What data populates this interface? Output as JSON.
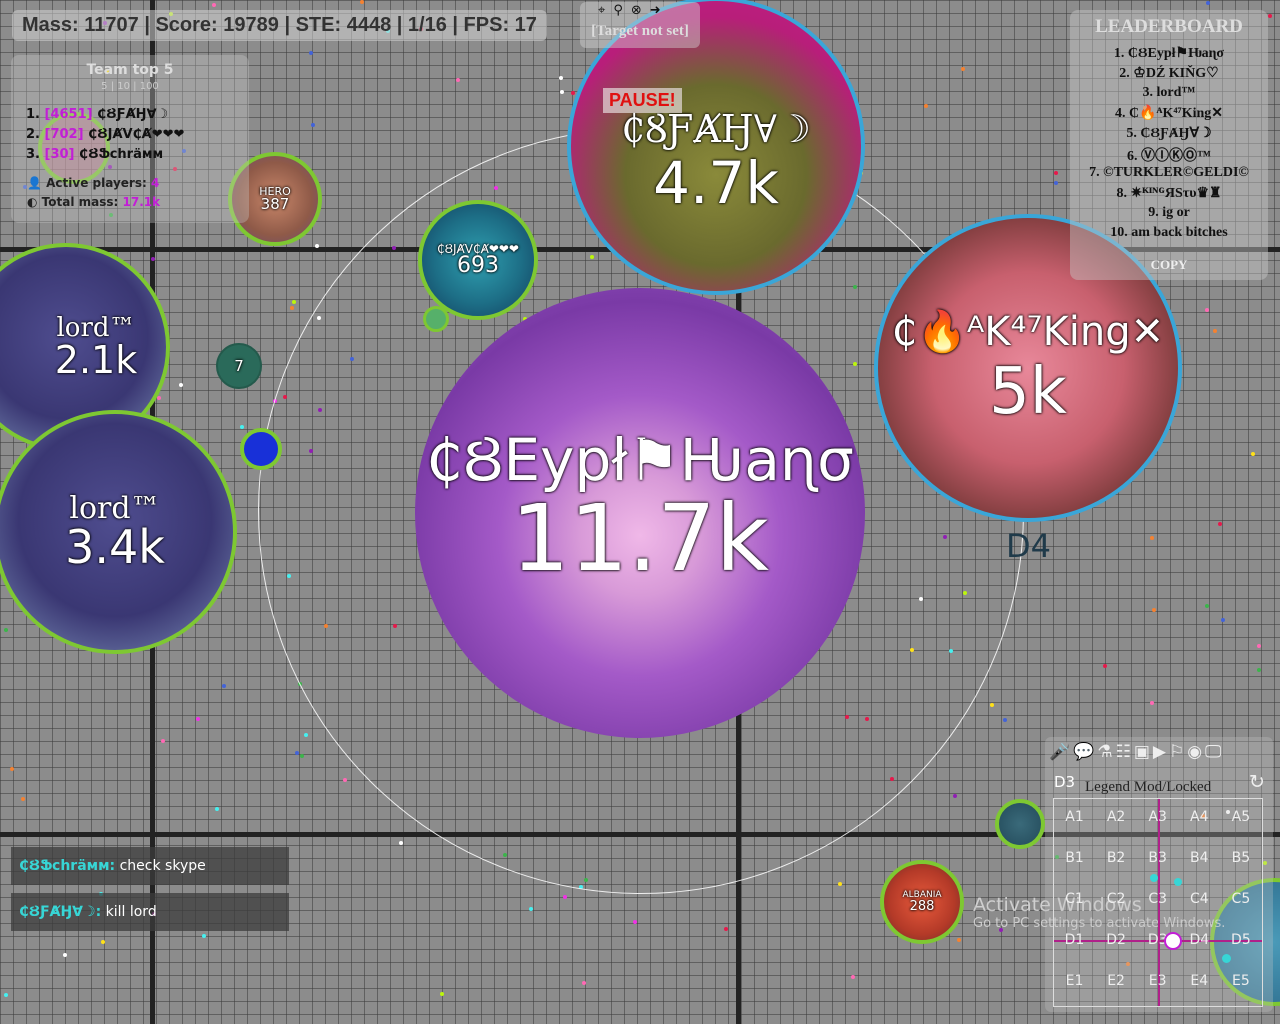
{
  "hud": {
    "stats": "Mass: 11707 | Score: 19789 | STE: 4448 | 1/16 | FPS: 17",
    "pause": "PAUSE!",
    "sector_label": "D4"
  },
  "target": {
    "icons": "⌖⚲⊗➜",
    "text": "[Target not set]"
  },
  "team": {
    "title": "Team top 5",
    "subtitle": "5 | 10 | 100",
    "members": [
      {
        "rank": "1.",
        "mass": "[4651]",
        "name": "₵ȢƑȺӇ∀☽"
      },
      {
        "rank": "2.",
        "mass": "[702]",
        "name": "₵ȢJȺV₵Ⱥ❤❤❤"
      },
      {
        "rank": "3.",
        "mass": "[30]",
        "name": "₵ȢՖchräмм"
      }
    ],
    "active_label": "Active players:",
    "active_value": "4",
    "total_label": "Total mass:",
    "total_value": "17.1k"
  },
  "leaderboard": {
    "title": "LEADERBOARD",
    "entries": [
      "1. ₵ȢЕурł⚑Ƕаɳσ",
      "2. ♔DŹ KIŇG♡",
      "3. lord™",
      "4. ₵🔥ᴬK⁴⁷King✕",
      "5. ₵ȢƑȺӇ∀☽",
      "6. ⓋⒾⓀⓄ™",
      "7. ©TURKLER©GELDI©",
      "8. ✷ᴷᴵᴺᴳЯЅτυ♛♜",
      "9. ig or",
      "10. am back bitches"
    ],
    "copy": "COPY"
  },
  "cells": {
    "main": {
      "name": "₵ȢЕурł⚑Ƕаɳσ",
      "mass": "11.7k"
    },
    "top": {
      "name": "₵ȢƑȺӇ∀☽",
      "mass": "4.7k"
    },
    "right": {
      "name": "₵🔥ᴬK⁴⁷King✕",
      "mass": "5k"
    },
    "lord1": {
      "name": "lord™",
      "mass": "2.1k"
    },
    "lord2": {
      "name": "lord™",
      "mass": "3.4k"
    },
    "javca": {
      "name": "₵ȢJȺV₵Ⱥ❤❤❤",
      "mass": "693"
    },
    "hero": {
      "name": "HERO",
      "mass": "387"
    },
    "seven": {
      "mass": "7"
    },
    "albania": {
      "name": "ALBANIA",
      "mass": "288"
    }
  },
  "chat": [
    {
      "who": "₵ȢՖchräмм:",
      "msg": "check skype"
    },
    {
      "who": "₵ȢƑȺӇ∀☽:",
      "msg": "kill lord"
    }
  ],
  "minimap": {
    "toolbar": "🎤💬⚗☷▣▶⚐◉🖵",
    "title": "Legend Mod/Locked",
    "corner_label": "D3",
    "refresh_icon": "↻",
    "sectors": [
      [
        "A1",
        "A2",
        "A3",
        "A4",
        "A5"
      ],
      [
        "B1",
        "B2",
        "B3",
        "B4",
        "B5"
      ],
      [
        "C1",
        "C2",
        "C3",
        "C4",
        "C5"
      ],
      [
        "D1",
        "D2",
        "D3",
        "D4",
        "D5"
      ],
      [
        "E1",
        "E2",
        "E3",
        "E4",
        "E5"
      ]
    ]
  },
  "watermark": {
    "line1": "Activate Windows",
    "line2": "Go to PC settings to activate Windows."
  },
  "colors": {
    "player_ring": "#7ec832",
    "enemy_ring": "#3aa6d8",
    "team_mass": "#c21ed6",
    "chat_name": "#37d6d6"
  }
}
